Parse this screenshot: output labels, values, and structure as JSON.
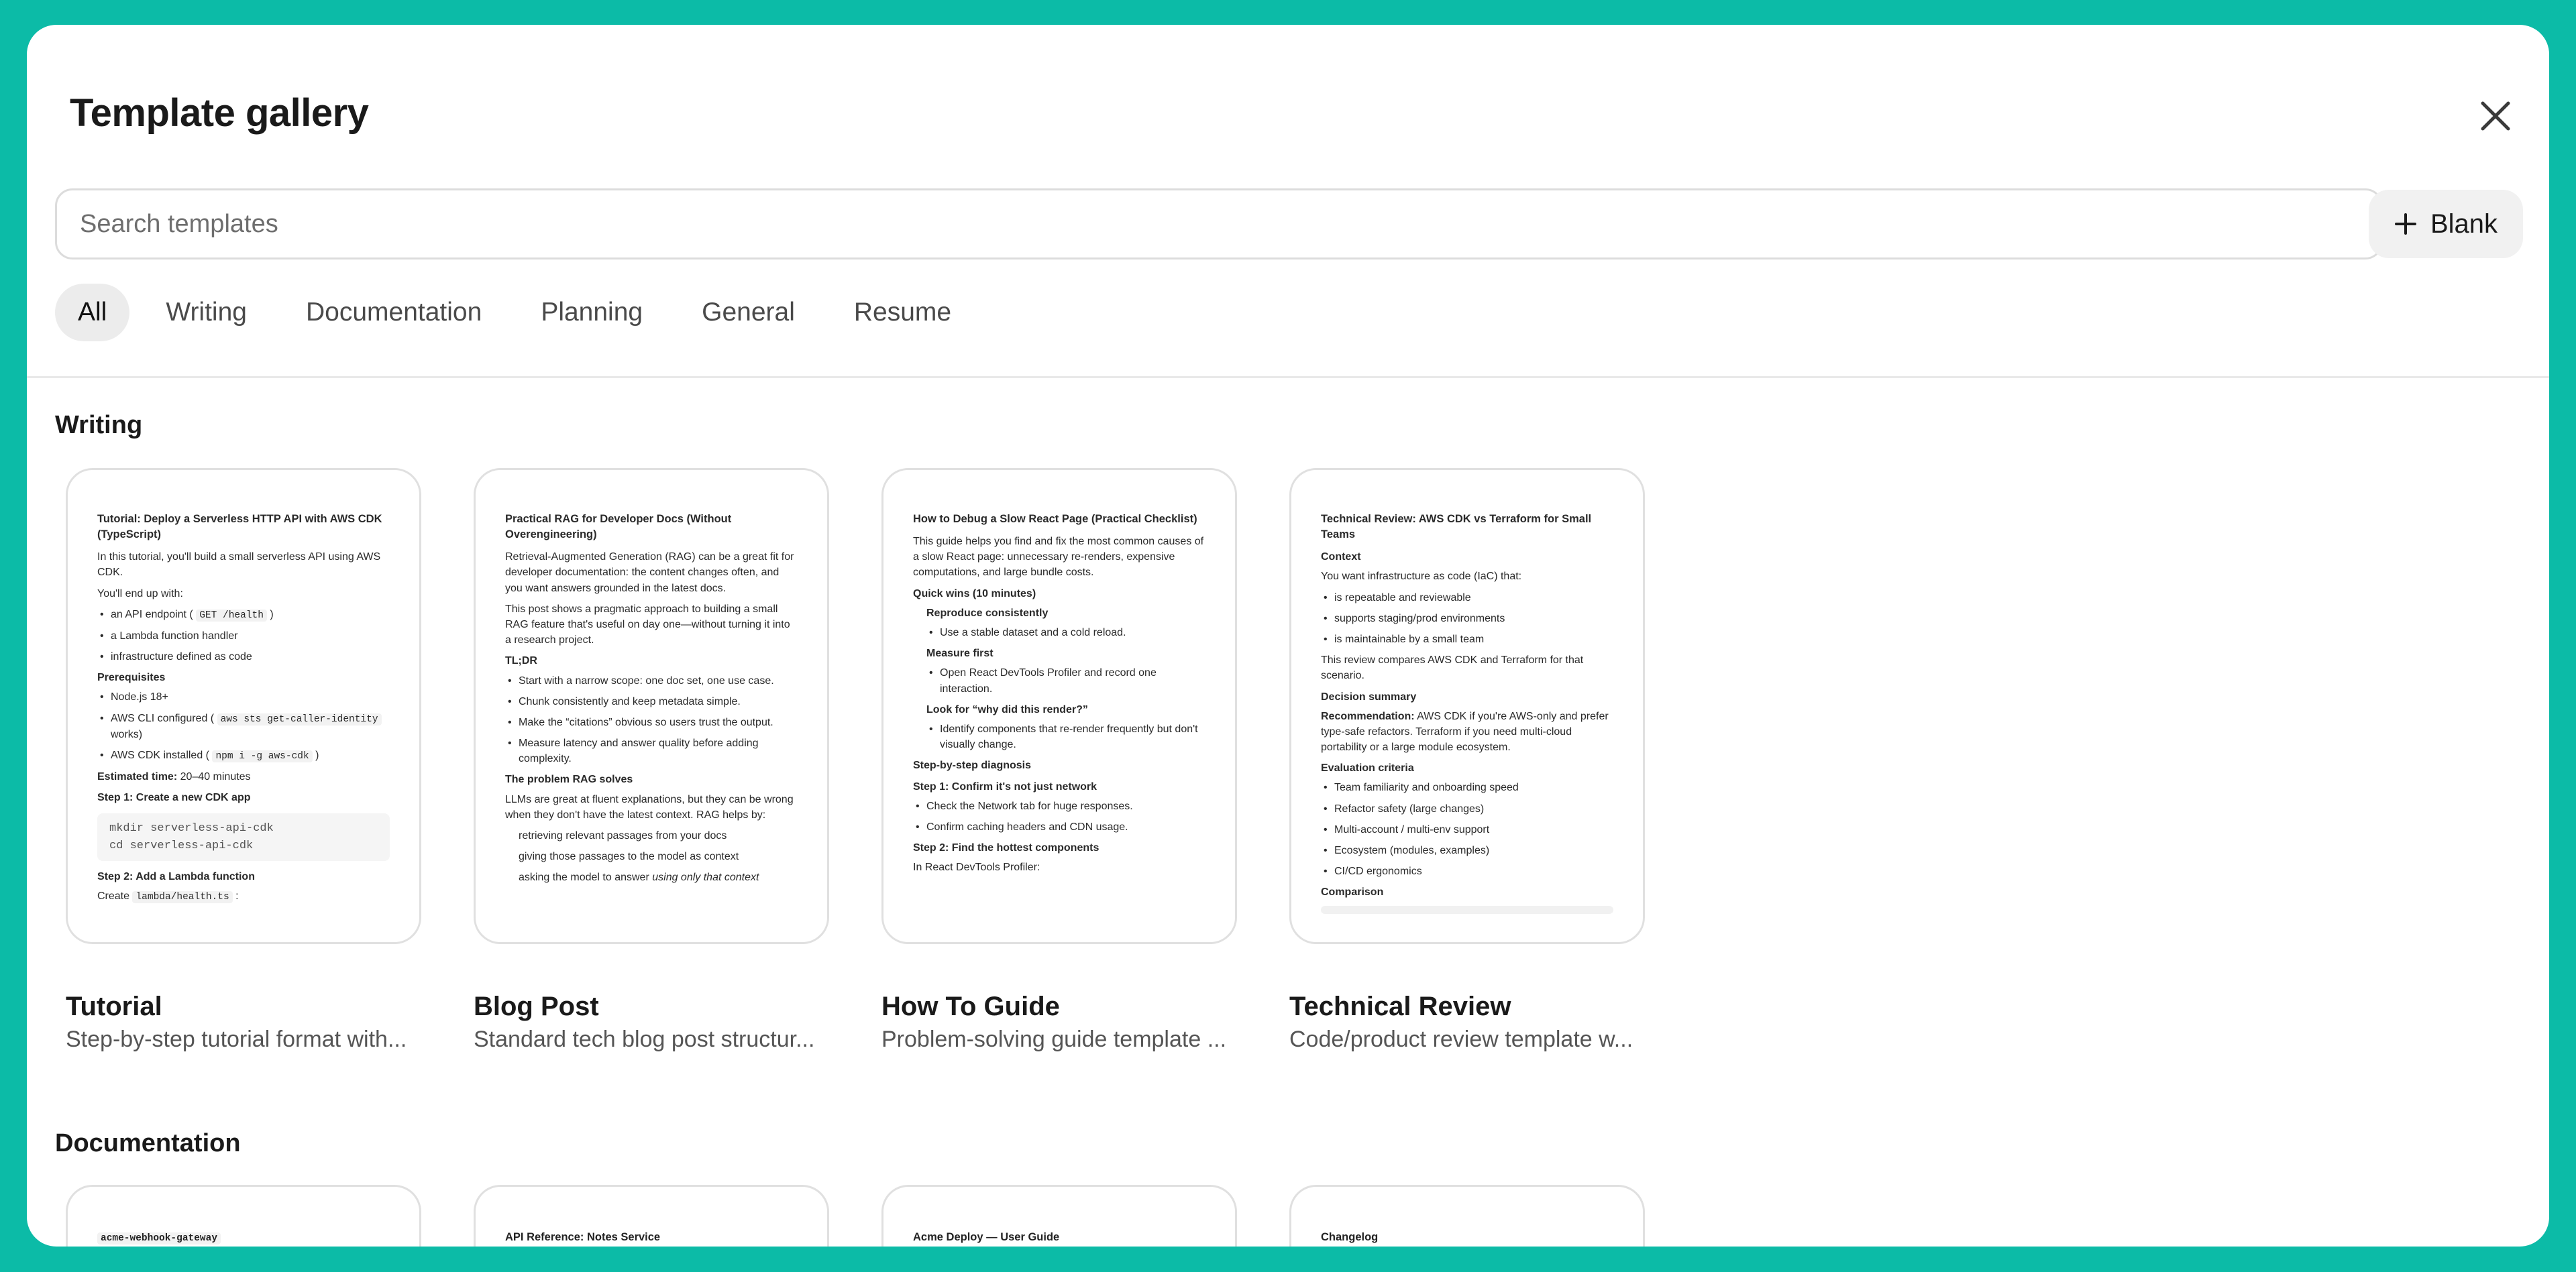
{
  "modal": {
    "title": "Template gallery",
    "close_icon": "close-icon"
  },
  "search": {
    "placeholder": "Search templates",
    "value": ""
  },
  "blank_button": {
    "label": "Blank",
    "icon": "plus-icon"
  },
  "tabs": [
    {
      "label": "All",
      "active": true
    },
    {
      "label": "Writing",
      "active": false
    },
    {
      "label": "Documentation",
      "active": false
    },
    {
      "label": "Planning",
      "active": false
    },
    {
      "label": "General",
      "active": false
    },
    {
      "label": "Resume",
      "active": false
    }
  ],
  "colors": {
    "background": "#0cbba7",
    "modal": "#ffffff",
    "active_tab": "#ececec",
    "card_border": "#e0e0e0"
  },
  "sections": [
    {
      "title": "Writing",
      "templates": [
        {
          "name": "Tutorial",
          "description": "Step-by-step tutorial format with...",
          "preview": {
            "title": "Tutorial: Deploy a Serverless HTTP API with AWS CDK (TypeScript)",
            "intro": "In this tutorial, you'll build a small serverless API using AWS CDK.",
            "end_up": "You'll end up with:",
            "items": [
              "an API endpoint (",
              "GET /health",
              ")",
              "a Lambda function handler",
              "infrastructure defined as code"
            ],
            "prereq_heading": "Prerequisites",
            "prereqs": [
              "Node.js 18+",
              "AWS CLI configured (",
              "aws sts get-caller-identity",
              "works)",
              "AWS CDK installed (",
              "npm i -g aws-cdk",
              ")"
            ],
            "est_label": "Estimated time:",
            "est_value": "20–40 minutes",
            "step1": "Step 1: Create a new CDK app",
            "code1": "mkdir serverless-api-cdk",
            "code2": "cd serverless-api-cdk",
            "step2": "Step 2: Add a Lambda function",
            "create": "Create",
            "create_code": "lambda/health.ts",
            "create_end": ":"
          }
        },
        {
          "name": "Blog Post",
          "description": "Standard tech blog post structur...",
          "preview": {
            "title": "Practical RAG for Developer Docs (Without Overengineering)",
            "p1": "Retrieval-Augmented Generation (RAG) can be a great fit for developer documentation: the content changes often, and you want answers grounded in the latest docs.",
            "p2": "This post shows a pragmatic approach to building a small RAG feature that's useful on day one—without turning it into a research project.",
            "h1": "TL;DR",
            "items": [
              "Start with a narrow scope: one doc set, one use case.",
              "Chunk consistently and keep metadata simple.",
              "Make the “citations” obvious so users trust the output.",
              "Measure latency and answer quality before adding complexity."
            ],
            "h2": "The problem RAG solves",
            "p3": "LLMs are great at fluent explanations, but they can be wrong when they don't have the latest context. RAG helps by:",
            "steps": [
              "retrieving relevant passages from your docs",
              "giving those passages to the model as context",
              "asking the model to answer"
            ],
            "steps_em": "using only that context"
          }
        },
        {
          "name": "How To Guide",
          "description": "Problem-solving guide template ...",
          "preview": {
            "title": "How to Debug a Slow React Page (Practical Checklist)",
            "p1": "This guide helps you find and fix the most common causes of a slow React page: unnecessary re-renders, expensive computations, and large bundle costs.",
            "h1": "Quick wins (10 minutes)",
            "sh1": "Reproduce consistently",
            "i1": "Use a stable dataset and a cold reload.",
            "sh2": "Measure first",
            "i2": "Open React DevTools Profiler and record one interaction.",
            "sh3": "Look for “why did this render?”",
            "i3": "Identify components that re-render frequently but don't visually change.",
            "h2": "Step-by-step diagnosis",
            "h3": "Step 1: Confirm it's not just network",
            "i4": "Check the Network tab for huge responses.",
            "i5": "Confirm caching headers and CDN usage.",
            "h4": "Step 2: Find the hottest components",
            "p2": "In React DevTools Profiler:"
          }
        },
        {
          "name": "Technical Review",
          "description": "Code/product review template w...",
          "preview": {
            "title": "Technical Review: AWS CDK vs Terraform for Small Teams",
            "h1": "Context",
            "p1": "You want infrastructure as code (IaC) that:",
            "items": [
              "is repeatable and reviewable",
              "supports staging/prod environments",
              "is maintainable by a small team"
            ],
            "p2": "This review compares AWS CDK and Terraform for that scenario.",
            "h2": "Decision summary",
            "rec_label": "Recommendation:",
            "rec_text": "AWS CDK if you're AWS-only and prefer type-safe refactors. Terraform if you need multi-cloud portability or a large module ecosystem.",
            "h3": "Evaluation criteria",
            "criteria": [
              "Team familiarity and onboarding speed",
              "Refactor safety (large changes)",
              "Multi-account / multi-env support",
              "Ecosystem (modules, examples)",
              "CI/CD ergonomics"
            ],
            "h4": "Comparison"
          }
        }
      ]
    },
    {
      "title": "Documentation",
      "templates": [
        {
          "preview_title": "acme-webhook-gateway"
        },
        {
          "preview_title": "API Reference: Notes Service"
        },
        {
          "preview_title": "Acme Deploy — User Guide"
        },
        {
          "preview_title": "Changelog"
        }
      ]
    }
  ]
}
